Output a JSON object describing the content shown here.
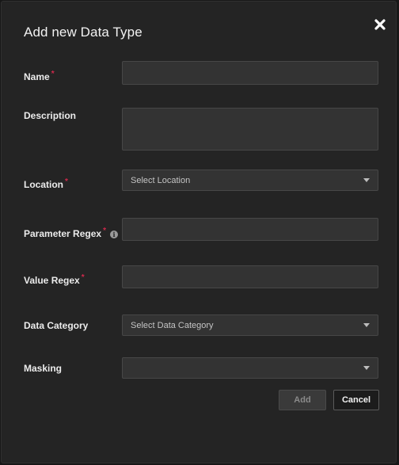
{
  "dialog": {
    "title": "Add new Data Type",
    "close_icon": "close-icon"
  },
  "form": {
    "name": {
      "label": "Name",
      "required_mark": "*",
      "value": ""
    },
    "description": {
      "label": "Description",
      "value": ""
    },
    "location": {
      "label": "Location",
      "required_mark": "*",
      "placeholder": "Select Location"
    },
    "parameter_regex": {
      "label": "Parameter Regex",
      "required_mark": "*",
      "info_icon": "info-icon",
      "value": ""
    },
    "value_regex": {
      "label": "Value Regex",
      "required_mark": "*",
      "value": ""
    },
    "data_category": {
      "label": "Data Category",
      "placeholder": "Select Data Category"
    },
    "masking": {
      "label": "Masking",
      "placeholder": ""
    }
  },
  "actions": {
    "add_label": "Add",
    "cancel_label": "Cancel"
  },
  "colors": {
    "background": "#242424",
    "input_bg": "#333333",
    "required": "#d0294c"
  }
}
